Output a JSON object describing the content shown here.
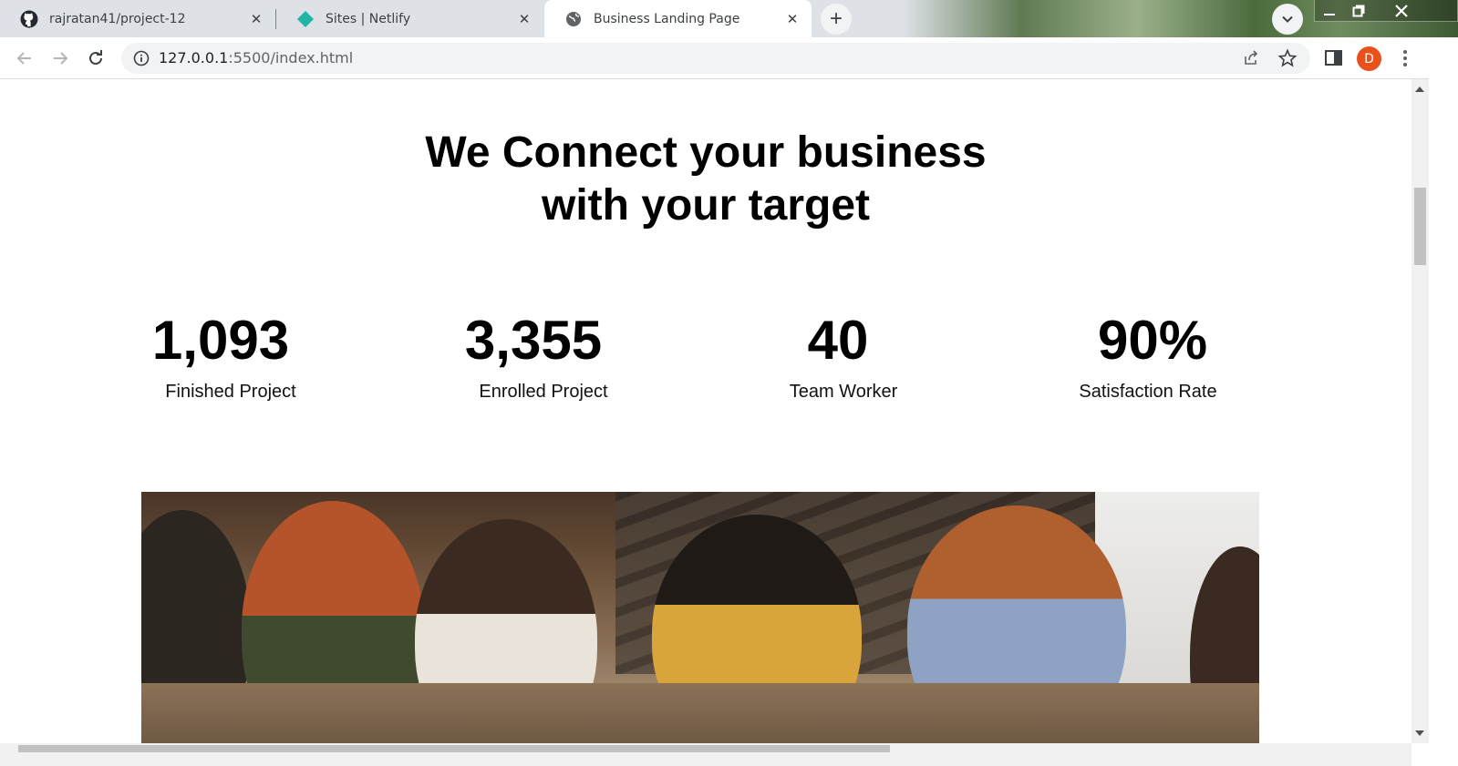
{
  "browser": {
    "tabs": [
      {
        "title": "rajratan41/project-12",
        "favicon": "github-icon",
        "active": false
      },
      {
        "title": "Sites | Netlify",
        "favicon": "netlify-icon",
        "active": false
      },
      {
        "title": "Business Landing Page",
        "favicon": "globe-icon",
        "active": true
      }
    ],
    "url_host": "127.0.0.1",
    "url_path": ":5500/index.html",
    "profile_initial": "D",
    "colors": {
      "profile": "#e8511c",
      "netlify": "#20b5a4"
    }
  },
  "page": {
    "headline_line1": "We Connect your business",
    "headline_line2": "with your target",
    "stats": [
      {
        "value": "1,093",
        "label": "Finished Project"
      },
      {
        "value": "3,355",
        "label": "Enrolled Project"
      },
      {
        "value": "40",
        "label": "Team Worker"
      },
      {
        "value": "90%",
        "label": "Satisfaction Rate"
      }
    ],
    "image_subject": "team-meeting-photo"
  }
}
